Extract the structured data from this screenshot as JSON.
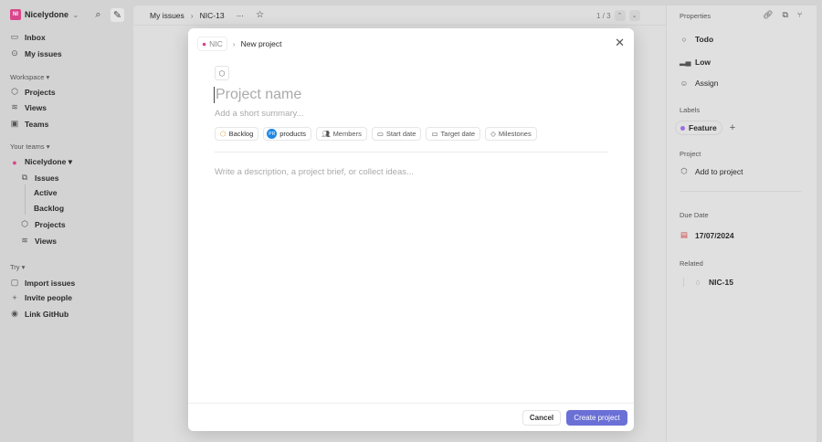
{
  "sidebar": {
    "workspace": "Nicelydone",
    "ws_initials": "NI",
    "top": [
      {
        "label": "Inbox",
        "icon": "inbox-icon"
      },
      {
        "label": "My issues",
        "icon": "target-icon"
      }
    ],
    "workspace_section": "Workspace ▾",
    "workspace_items": [
      "Projects",
      "Views",
      "Teams"
    ],
    "teams_section": "Your teams ▾",
    "team": "Nicelydone ▾",
    "team_items": [
      "Issues",
      "Active",
      "Backlog",
      "Projects",
      "Views"
    ],
    "try_section": "Try ▾",
    "try_items": [
      "Import issues",
      "Invite people",
      "Link GitHub"
    ]
  },
  "header": {
    "crumb1": "My issues",
    "crumb2": "NIC-13",
    "pager": "1 / 3"
  },
  "properties": {
    "title": "Properties",
    "status": "Todo",
    "priority": "Low",
    "assignee": "Assign",
    "labels_title": "Labels",
    "label": "Feature",
    "label_color": "#9b6ee0",
    "project_title": "Project",
    "project": "Add to project",
    "due_title": "Due Date",
    "due": "17/07/2024",
    "related_title": "Related",
    "related": "NIC-15"
  },
  "modal": {
    "team": "NIC",
    "crumb": "New project",
    "name_placeholder": "Project name",
    "summary_placeholder": "Add a short summary...",
    "chips": {
      "status": "Backlog",
      "lead_initials": "PR",
      "lead": "products",
      "members": "Members",
      "start": "Start date",
      "target": "Target date",
      "milestones": "Milestones"
    },
    "description_placeholder": "Write a description, a project brief, or collect ideas...",
    "cancel": "Cancel",
    "create": "Create project",
    "accent": "#6b70d6"
  }
}
